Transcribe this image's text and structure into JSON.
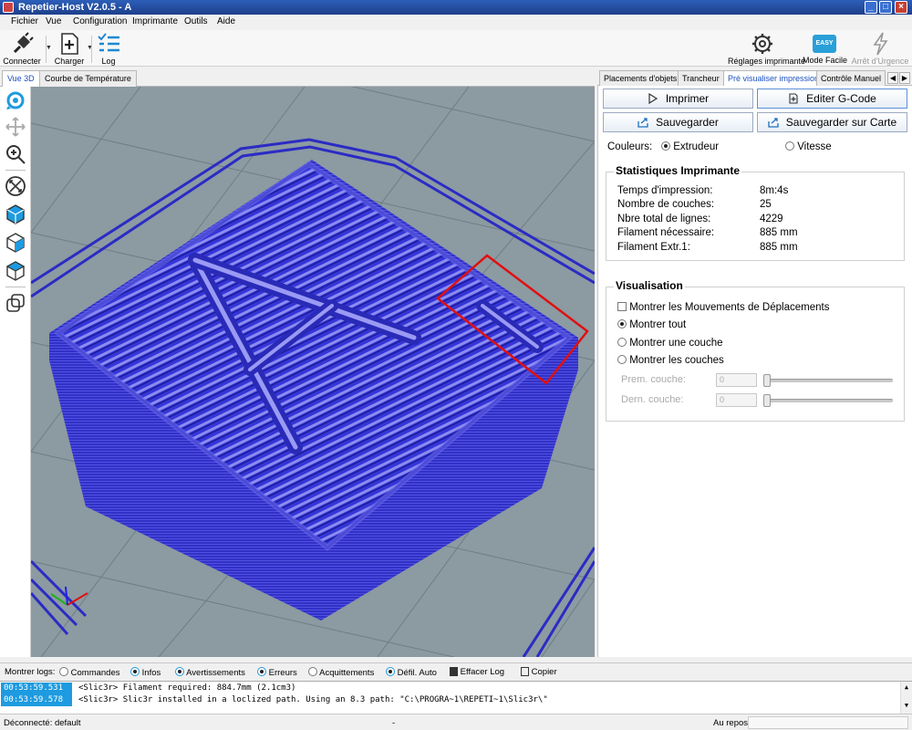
{
  "window": {
    "title": "Repetier-Host V2.0.5 - A"
  },
  "menu": [
    "Fichier",
    "Vue",
    "Configuration",
    "Imprimante",
    "Outils",
    "Aide"
  ],
  "toolbar": {
    "connect": "Connecter",
    "load": "Charger",
    "log": "Log",
    "printer_settings": "Réglages imprimante",
    "easy_badge": "EASY",
    "easy_mode": "Mode Facile",
    "emergency_stop": "Arrêt d'Urgence"
  },
  "left_tabs": [
    "Vue 3D",
    "Courbe de Température"
  ],
  "right_tabs": [
    "Placements d'objets",
    "Trancheur",
    "Pré visualiser impression",
    "Contrôle Manuel"
  ],
  "preview": {
    "print_btn": "Imprimer",
    "edit_gcode_btn": "Editer G-Code",
    "save_btn": "Sauvegarder",
    "save_card_btn": "Sauvegarder sur Carte",
    "colors_label": "Couleurs:",
    "color_extruder": "Extrudeur",
    "color_speed": "Vitesse",
    "color_selected": "Extrudeur"
  },
  "stats": {
    "title": "Statistiques Imprimante",
    "rows": [
      {
        "label": "Temps d'impression:",
        "value": "8m:4s"
      },
      {
        "label": "Nombre de couches:",
        "value": "25"
      },
      {
        "label": "Nbre total de lignes:",
        "value": "4229"
      },
      {
        "label": "Filament nécessaire:",
        "value": "885 mm"
      },
      {
        "label": "Filament Extr.1:",
        "value": "885 mm"
      }
    ]
  },
  "visualisation": {
    "title": "Visualisation",
    "show_travel": "Montrer les Mouvements de Déplacements",
    "show_travel_checked": false,
    "show_all": "Montrer tout",
    "show_one_layer": "Montrer une couche",
    "show_layers": "Montrer les couches",
    "selected": "Montrer tout",
    "first_layer_label": "Prem. couche:",
    "first_layer_value": "0",
    "last_layer_label": "Dern. couche:",
    "last_layer_value": "0"
  },
  "log_toolbar": {
    "label": "Montrer logs:",
    "options": [
      {
        "label": "Commandes",
        "checked": false
      },
      {
        "label": "Infos",
        "checked": true
      },
      {
        "label": "Avertissements",
        "checked": true
      },
      {
        "label": "Erreurs",
        "checked": true
      },
      {
        "label": "Acquittements",
        "checked": false
      },
      {
        "label": "Défil. Auto",
        "checked": true
      }
    ],
    "clear": "Effacer Log",
    "copy": "Copier"
  },
  "log": [
    {
      "time": "00:53:59.531",
      "msg": "<Slic3r> Filament required: 884.7mm (2.1cm3)"
    },
    {
      "time": "00:53:59.578",
      "msg": "<Slic3r> Slic3r installed in a loclized path. Using an 8.3 path: \"C:\\PROGRA~1\\REPETI~1\\Slic3r\\\""
    }
  ],
  "status": {
    "connection": "Déconnecté: default",
    "middle": "-",
    "state": "Au repos"
  },
  "colors": {
    "accent": "#1e9be0",
    "model": "#3535d8",
    "background": "#8c9aa2",
    "highlight": "#e01010"
  }
}
